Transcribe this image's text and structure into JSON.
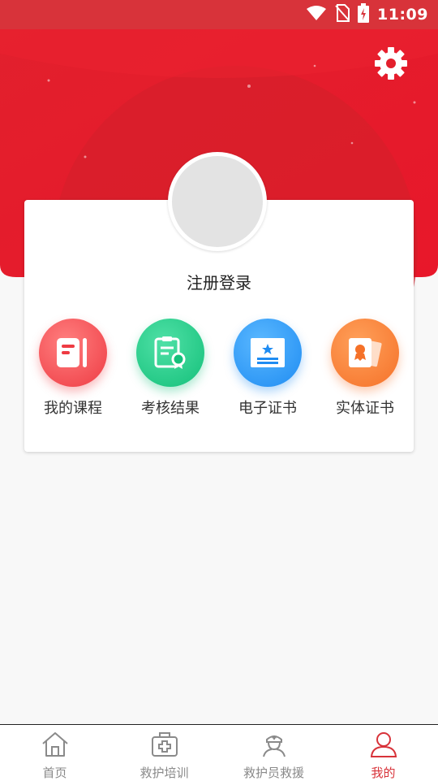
{
  "status_bar": {
    "time": "11:09"
  },
  "header": {
    "settings_icon": "gear-icon"
  },
  "profile": {
    "login_label": "注册登录"
  },
  "menu": [
    {
      "label": "我的课程",
      "icon": "course-book-icon",
      "color": "#ee3b43"
    },
    {
      "label": "考核结果",
      "icon": "exam-result-icon",
      "color": "#14c07a"
    },
    {
      "label": "电子证书",
      "icon": "e-certificate-icon",
      "color": "#1f8cf2"
    },
    {
      "label": "实体证书",
      "icon": "physical-certificate-icon",
      "color": "#f57128"
    }
  ],
  "tabbar": [
    {
      "label": "首页",
      "icon": "home-icon",
      "active": false
    },
    {
      "label": "救护培训",
      "icon": "medical-kit-icon",
      "active": false
    },
    {
      "label": "救护员救援",
      "icon": "nurse-icon",
      "active": false
    },
    {
      "label": "我的",
      "icon": "user-icon",
      "active": true
    }
  ],
  "colors": {
    "primary": "#d8333a",
    "tab_inactive": "#8a8a8a"
  }
}
